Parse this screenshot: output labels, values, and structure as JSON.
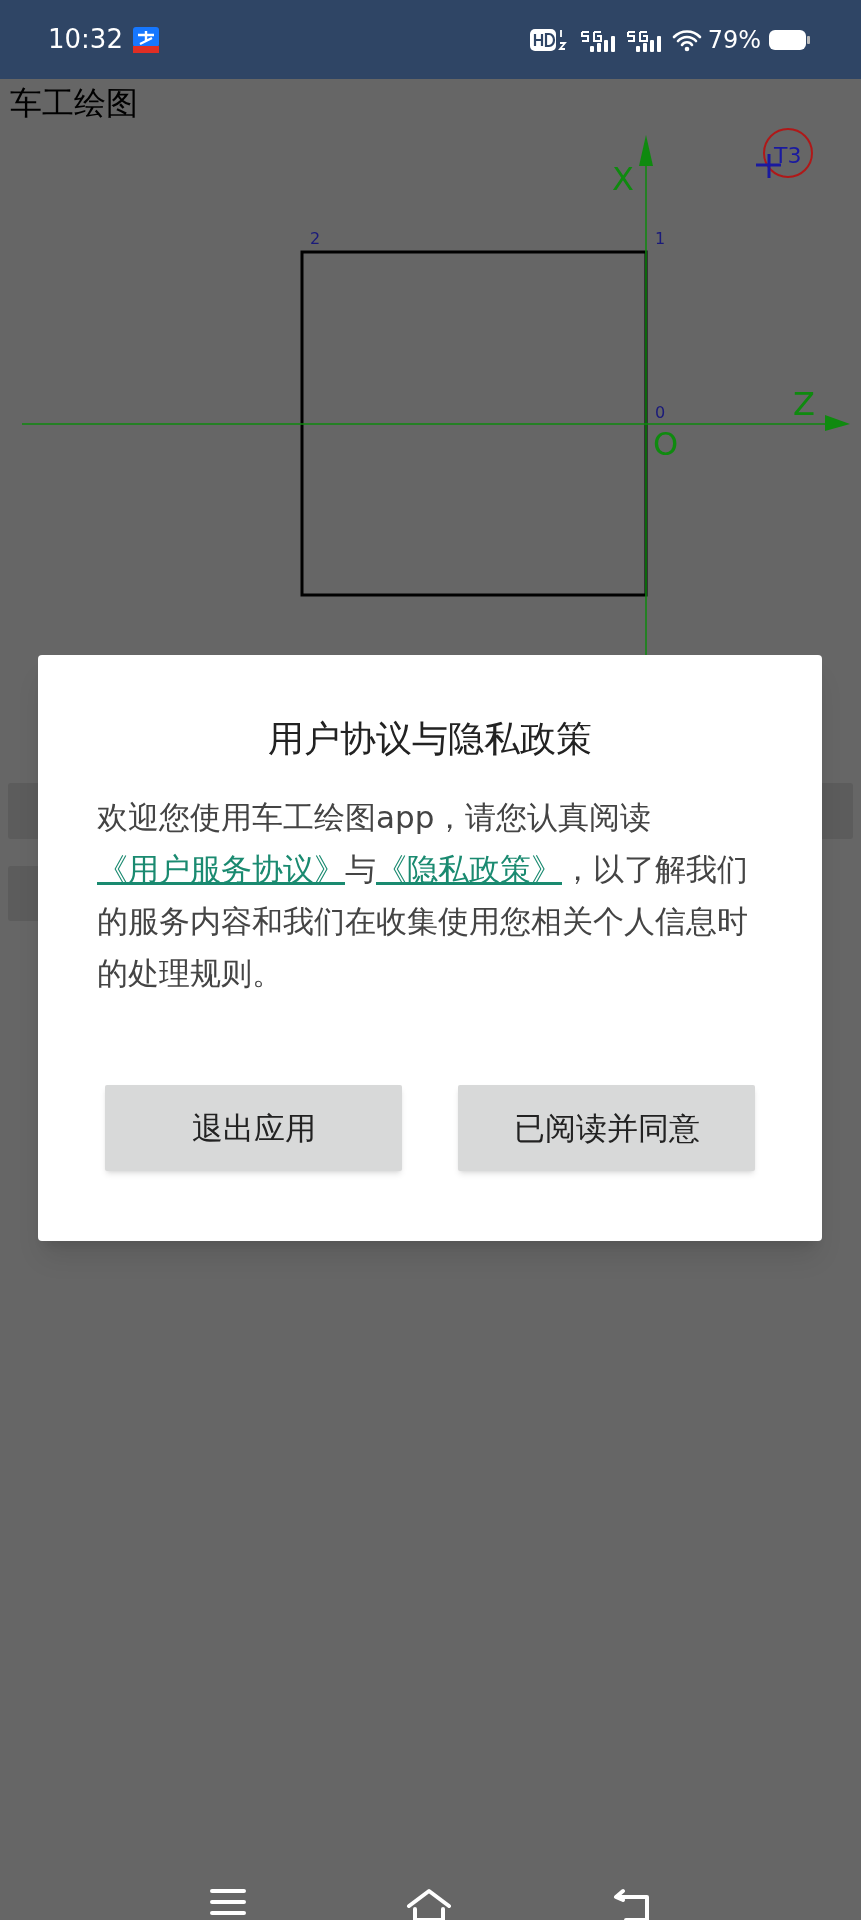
{
  "status_bar": {
    "time": "10:32",
    "battery": "79%"
  },
  "app": {
    "title": "车工绘图"
  },
  "drawing": {
    "axes": [
      {
        "kind": "x",
        "label": "X"
      },
      {
        "kind": "z",
        "label": "Z"
      }
    ],
    "origin_label": "O",
    "points": [
      {
        "label": "2"
      },
      {
        "label": "1"
      },
      {
        "label": "0"
      }
    ],
    "tool_label": "T3"
  },
  "dialog": {
    "title": "用户协议与隐私政策",
    "body": [
      {
        "kind": "text",
        "text": "欢迎您使用车工绘图app，请您认真阅读"
      },
      {
        "kind": "link",
        "text": "《用户服务协议》"
      },
      {
        "kind": "text",
        "text": "与"
      },
      {
        "kind": "link",
        "text": "《隐私政策》"
      },
      {
        "kind": "text",
        "text": "，以了解我们的服务内容和我们在收集使用您相关个人信息时的处理规则。"
      }
    ],
    "buttons": [
      {
        "label": "退出应用"
      },
      {
        "label": "已阅读并同意"
      }
    ]
  }
}
